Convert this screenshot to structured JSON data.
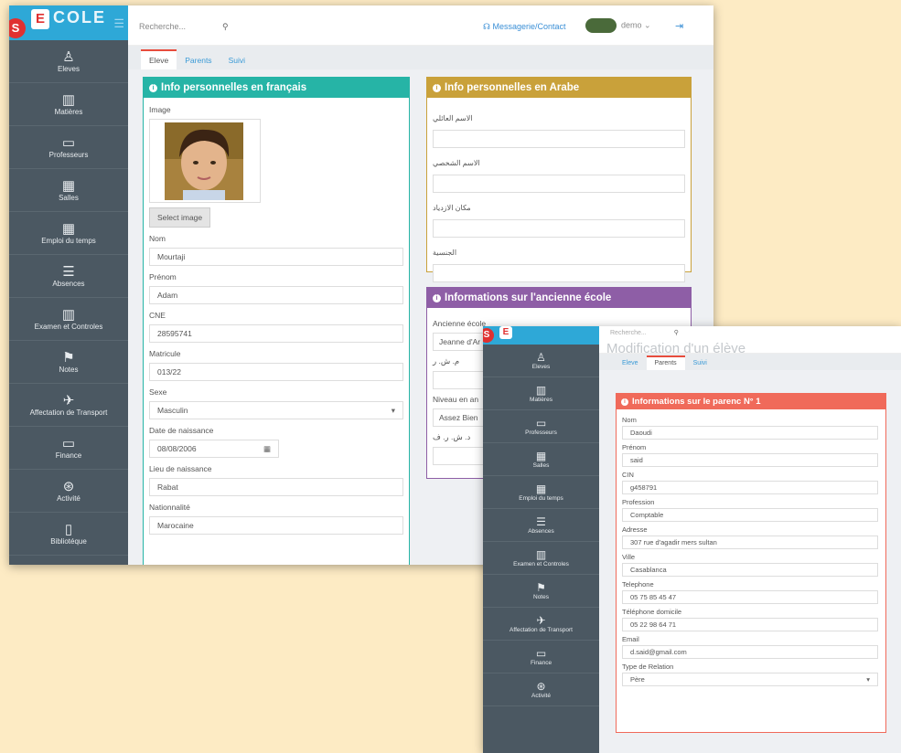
{
  "window1": {
    "logo": {
      "badge": "S",
      "letter": "E",
      "text": "COLE"
    },
    "sidebar": [
      {
        "icon": "♙",
        "label": "Eleves"
      },
      {
        "icon": "▥",
        "label": "Matières"
      },
      {
        "icon": "▭",
        "label": "Professeurs"
      },
      {
        "icon": "▦",
        "label": "Salles"
      },
      {
        "icon": "▦",
        "label": "Emploi du temps"
      },
      {
        "icon": "☰",
        "label": "Absences"
      },
      {
        "icon": "▥",
        "label": "Examen et Controles"
      },
      {
        "icon": "⚑",
        "label": "Notes"
      },
      {
        "icon": "✈",
        "label": "Affectation de Transport"
      },
      {
        "icon": "▭",
        "label": "Finance"
      },
      {
        "icon": "⊛",
        "label": "Activité"
      },
      {
        "icon": "▯",
        "label": "Bibliotéque"
      }
    ],
    "topbar": {
      "search_placeholder": "Recherche...",
      "messaging": "Messagerie/Contact",
      "user": "demo",
      "user_caret": "⌄",
      "logout_icon": "⇥"
    },
    "tabs": [
      "Eleve",
      "Parents",
      "Suivi"
    ],
    "french_panel": {
      "title": "Info personnelles en français",
      "color": "#26b4a6",
      "image_label": "Image",
      "select_image": "Select image",
      "fields": [
        {
          "label": "Nom",
          "value": "Mourtaji"
        },
        {
          "label": "Prénom",
          "value": "Adam"
        },
        {
          "label": "CNE",
          "value": "28595741"
        },
        {
          "label": "Matricule",
          "value": "013/22"
        },
        {
          "label": "Sexe",
          "value": "Masculin",
          "suffix": "▾"
        },
        {
          "label": "Date de naissance",
          "value": "08/08/2006",
          "suffix": "▦"
        },
        {
          "label": "Lieu de naissance",
          "value": "Rabat"
        },
        {
          "label": "Nationnalité",
          "value": "Marocaine"
        }
      ]
    },
    "arabic_panel": {
      "title": "Info personnelles en Arabe",
      "color": "#c9a13a",
      "fields": [
        {
          "label": "الاسم العائلي",
          "value": ""
        },
        {
          "label": "الاسم الشخصي",
          "value": ""
        },
        {
          "label": "مكان الازدياد",
          "value": ""
        },
        {
          "label": "الجنسية",
          "value": ""
        }
      ]
    },
    "school_panel": {
      "title": "Informations sur l'ancienne école",
      "color": "#8e5ea6",
      "fields": [
        {
          "label": "Ancienne école",
          "value": "Jeanne d'Ar"
        },
        {
          "label": "م. ش. ر",
          "value": ""
        },
        {
          "label": "Niveau en an",
          "value": "Assez Bien"
        },
        {
          "label": "د. ش. ر. ف",
          "value": ""
        }
      ]
    }
  },
  "window2": {
    "logo": {
      "badge": "S",
      "letter": "E"
    },
    "sidebar": [
      {
        "icon": "♙",
        "label": "Eleves"
      },
      {
        "icon": "▥",
        "label": "Matières"
      },
      {
        "icon": "▭",
        "label": "Professeurs"
      },
      {
        "icon": "▦",
        "label": "Salles"
      },
      {
        "icon": "▦",
        "label": "Emploi du temps"
      },
      {
        "icon": "☰",
        "label": "Absences"
      },
      {
        "icon": "▥",
        "label": "Examen et Controles"
      },
      {
        "icon": "⚑",
        "label": "Notes"
      },
      {
        "icon": "✈",
        "label": "Affectation de Transport"
      },
      {
        "icon": "▭",
        "label": "Finance"
      },
      {
        "icon": "⊛",
        "label": "Activité"
      }
    ],
    "topbar": {
      "search_placeholder": "Recherche...",
      "heading": "Modification d'un élève"
    },
    "tabs": [
      "Eleve",
      "Parents",
      "Suivi"
    ],
    "parent_panel": {
      "title": "Informations sur le parenc N° 1",
      "color": "#f06a5a",
      "fields": [
        {
          "label": "Nom",
          "value": "Daoudi"
        },
        {
          "label": "Prénom",
          "value": "said"
        },
        {
          "label": "CIN",
          "value": "g458791"
        },
        {
          "label": "Profession",
          "value": "Comptable"
        },
        {
          "label": "Adresse",
          "value": "307 rue d'agadir mers sultan"
        },
        {
          "label": "Ville",
          "value": "Casablanca"
        },
        {
          "label": "Telephone",
          "value": "05 75 85 45 47"
        },
        {
          "label": "Téléphone domicile",
          "value": "05 22 98 64 71"
        },
        {
          "label": "Email",
          "value": "d.said@gmail.com"
        },
        {
          "label": "Type de Relation",
          "value": "Père",
          "suffix": "▾"
        }
      ]
    }
  }
}
